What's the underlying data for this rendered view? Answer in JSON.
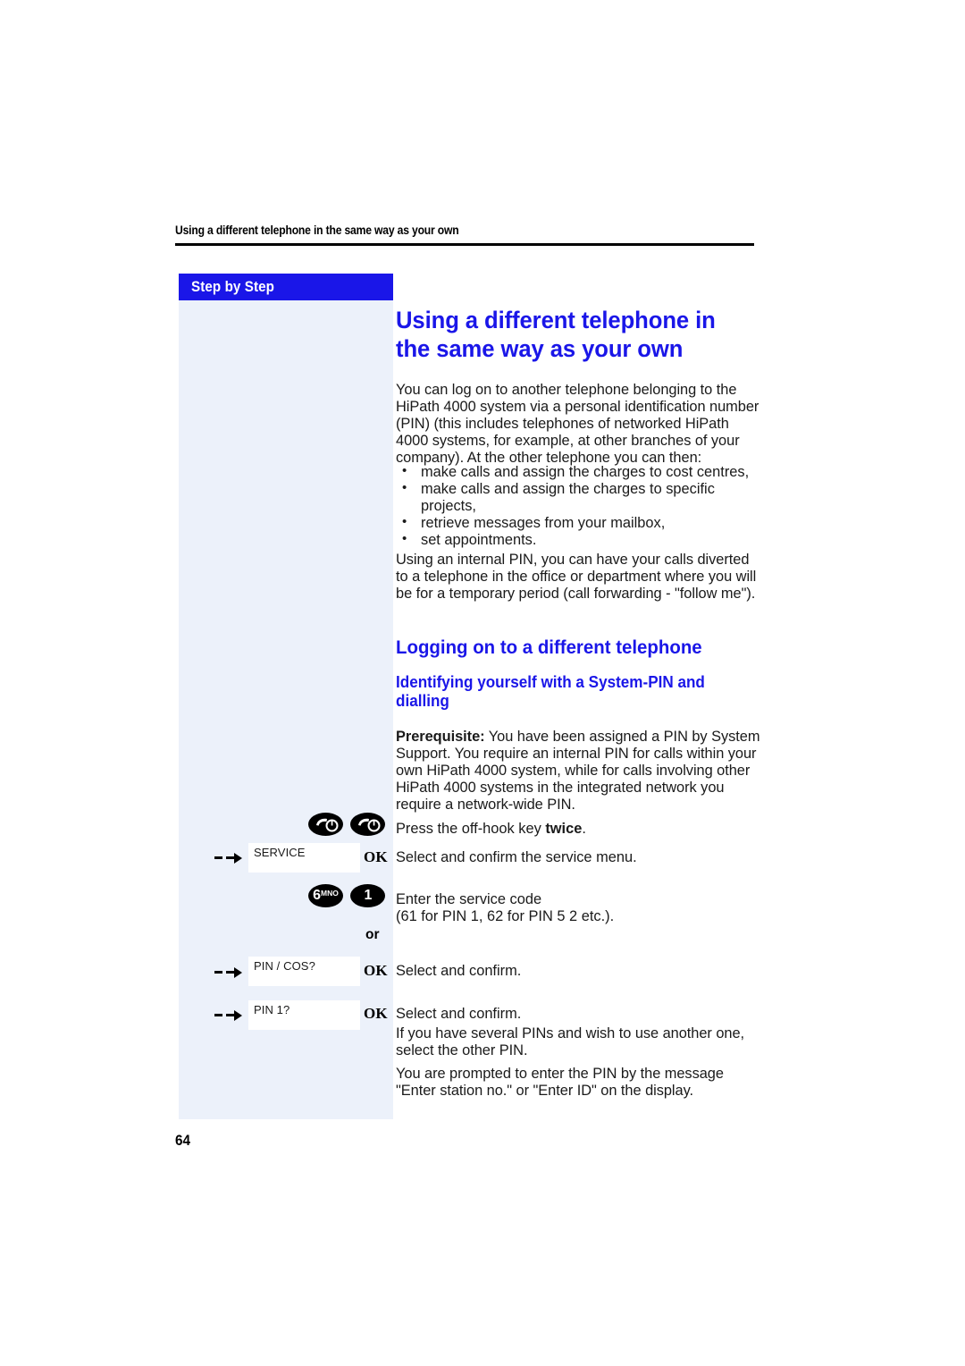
{
  "page": {
    "running_header": "Using a different telephone in the same way as your own",
    "page_number": "64",
    "accent_blue": "#1a16e8",
    "panel_blue": "#ecf1fa"
  },
  "sidebar": {
    "banner_label": "Step by Step"
  },
  "content": {
    "title": "Using a different telephone in the same way as your own",
    "intro_paragraph": "You can log on to another telephone belonging to the HiPath 4000 system via a personal identification number (PIN) (this includes telephones of networked HiPath 4000 systems, for example, at other branches of your company).  At the other telephone you can then:",
    "bullets": [
      "make calls and assign the charges to cost centres,",
      "make calls and assign the charges to specific projects,",
      "retrieve messages from your mailbox,",
      "set appointments."
    ],
    "internal_pin_paragraph": "Using an internal PIN, you can have your calls diverted to a telephone in the office or department where you will be for a temporary period (call forwarding - \"follow me\").",
    "heading_2": "Logging on to a different telephone",
    "heading_3": "Identifying yourself with a System-PIN and dialling",
    "prerequisite_label": "Prerequisite:",
    "prerequisite_text": " You have been assigned a PIN by System Support. You require an internal PIN for calls within your own HiPath 4000 system, while for calls involving other HiPath 4000 systems in the integrated network you require a network-wide PIN.",
    "closing_paragraph_1": "If you have several PINs and wish to use another one, select the other PIN.",
    "closing_paragraph_2": "You are prompted to enter the PIN by the message \"Enter station no.\" or \"Enter ID\" on the display."
  },
  "steps": {
    "or_label": "or",
    "ok_label": "OK",
    "step1_text_a": "Press the off-hook key ",
    "step1_text_b": "twice",
    "step1_text_c": ".",
    "step2_text": "Select and confirm the service menu.",
    "step3_line1": "Enter the service code",
    "step3_line2": "(61 for PIN 1, 62 for PIN 5 2 etc.).",
    "step4_text": "Select and confirm.",
    "step5_text": "Select and confirm.",
    "display_service": "SERVICE",
    "display_pin_cos": "PIN / COS?",
    "display_pin1": "PIN 1?",
    "key_6_digit": "6",
    "key_6_letters": "MNO",
    "key_1_digit": "1"
  }
}
